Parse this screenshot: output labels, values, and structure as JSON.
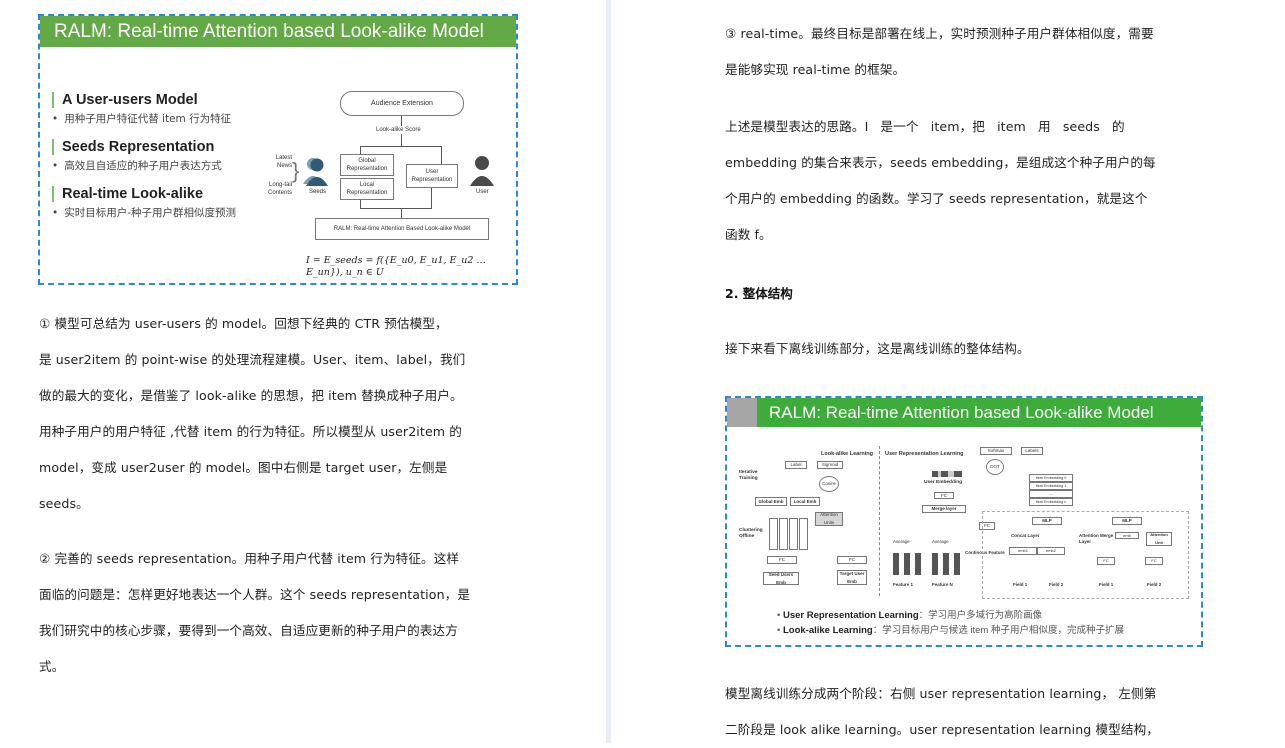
{
  "left_page": {
    "slide": {
      "title": "RALM: Real-time Attention based Look-alike Model",
      "sections": [
        {
          "title": "A User-users Model",
          "subtitle": "用种子用户特征代替 item 行为特征"
        },
        {
          "title": "Seeds Representation",
          "subtitle": "高效且自适应的种子用户表达方式"
        },
        {
          "title": "Real-time Look-alike",
          "subtitle": "实时目标用户-种子用户群相似度预测"
        }
      ],
      "diagram": {
        "audience_extension": "Audience Extension",
        "lookalike_score": "Look-alike Score",
        "global_rep": "Global Representation",
        "local_rep": "Local Representation",
        "user_rep": "User Representation",
        "latest_news": "Latest News",
        "longtail_contents": "Long-tail Contents",
        "seeds_label": "Seeds",
        "user_label": "User",
        "ralm_box": "RALM: Real-time Attention Based Look-alike Model",
        "formula": "I = E_seeds = f({E_u0, E_u1, E_u2 … E_un}), u_n ∈ U",
        "seeds_color": "#2f5b78",
        "user_color": "#4a4a4a"
      }
    },
    "para1": [
      "① 模型可总结为 user-users 的 model。回想下经典的 CTR 预估模型，",
      "是 user2item 的 point-wise 的处理流程建模。User、item、label，我们",
      "做的最大的变化，是借鉴了 look-alike 的思想，把 item 替换成种子用户。",
      "用种子用户的用户特征 ,代替 item 的行为特征。所以模型从 user2item 的",
      "model，变成 user2user 的 model。图中右侧是 target user，左侧是",
      "seeds。"
    ],
    "para2": [
      "② 完善的 seeds representation。用种子用户代替 item 行为特征。这样",
      "面临的问题是：怎样更好地表达一个人群。这个 seeds representation，是",
      "我们研究中的核心步骤，要得到一个高效、自适应更新的种子用户的表达方",
      "式。"
    ]
  },
  "right_page": {
    "para3": [
      "③ real-time。最终目标是部署在线上，实时预测种子用户群体相似度，需要",
      "是能够实现 real-time 的框架。"
    ],
    "para4": [
      "上述是模型表达的思路。I 是一个 item，把 item 用 seeds 的",
      "embedding 的集合来表示，seeds embedding，是组成这个种子用户的每",
      "个用户的 embedding 的函数。学习了 seeds representation，就是这个",
      "函数 f。"
    ],
    "heading": "2. 整体结构",
    "para5": "接下来看下离线训练部分，这是离线训练的整体结构。",
    "slide": {
      "title": "RALM: Real-time Attention based Look-alike Model",
      "diagram": {
        "lookalike_learning": "Look-alike Learning",
        "user_rep_learning": "User Representation Learning",
        "label": "Label",
        "sigmoid": "Sigmoid",
        "cosine": "Cosine",
        "iterative_training": "Iterative Training",
        "global_emb": "Global Emb",
        "local_emb": "Local Emb",
        "attention_units": "Attention Units",
        "clustering_offline": "Clustering Offline",
        "fc": "FC",
        "seed_users_emb": "Seed Users Emb",
        "target_user_emb": "Target User Emb",
        "softmax": "Softmax",
        "labels": "Labels",
        "dot": "DOT",
        "user_embedding": "User Embedding",
        "merge_layer": "Merge layer",
        "average": "Average",
        "continuous_feature": "Continous Feature",
        "item_embeddings": [
          "Item Embedding 0",
          "Item Embedding 1",
          "....",
          "Item Embedding n"
        ],
        "mlp": "MLP",
        "concat_layer": "Concat Layer",
        "emb1": "emb1",
        "emb2": "emb2",
        "emb": "emb",
        "attention_merge_layer": "Attention Merge Layer",
        "attention_unit": "Attention Unit",
        "field1": "Field 1",
        "field2": "Field 2",
        "feature1": "Feature 1",
        "featureN": "Feature N"
      },
      "bullets": [
        {
          "bold": "User Representation Learning",
          "text": "：学习用户多域行为高阶画像"
        },
        {
          "bold": "Look-alike Learning",
          "text": "：学习目标用户与候选 item 种子用户相似度，完成种子扩展"
        }
      ]
    },
    "para6": [
      "模型离线训练分成两个阶段：右侧 user representation learning， 左侧第",
      "二阶段是 look alike learning。user representation learning 模型结构，"
    ]
  }
}
